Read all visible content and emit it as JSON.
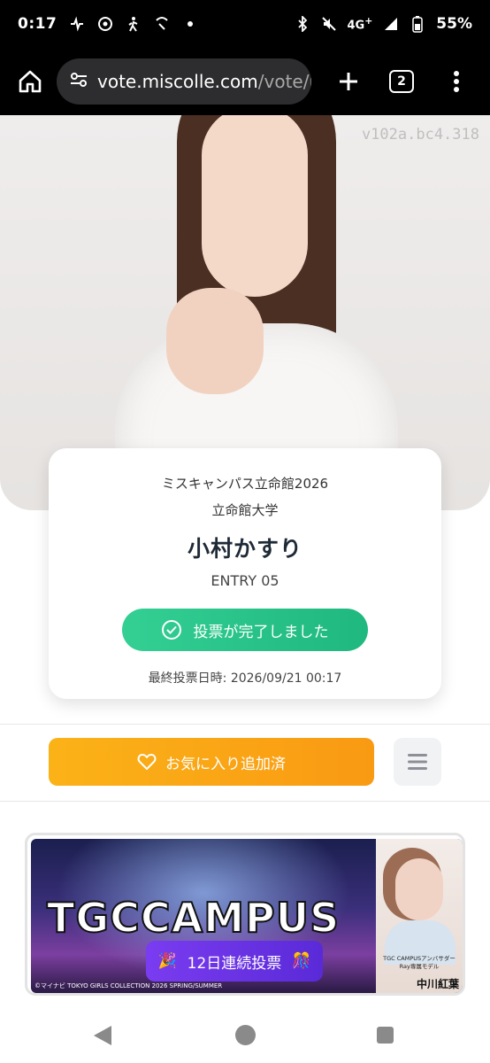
{
  "status_bar": {
    "time": "0:17",
    "network": "4G",
    "network_sup": "+",
    "battery": "55%"
  },
  "browser": {
    "url_main": "vote.miscolle.com",
    "url_dim": "/vote/r",
    "tab_count": "2"
  },
  "hero": {
    "watermark": "v102a.bc4.318"
  },
  "entry": {
    "contest": "ミスキャンパス立命館2026",
    "university": "立命館大学",
    "name": "小村かすり",
    "entry_number": "ENTRY 05",
    "vote_status": "投票が完了しました",
    "last_vote": "最終投票日時: 2026/09/21 00:17",
    "status_color": "#2cc58b"
  },
  "actions": {
    "favorite_label": "お気に入り追加済",
    "favorite_color": "#f9a815"
  },
  "banner": {
    "title": "TGCCAMPUS",
    "vote_label": "12日連続投票",
    "credit": "©マイナビ TOKYO GIRLS COLLECTION 2026 SPRING/SUMMER",
    "model_role": "TGC CAMPUSアンバサダー",
    "model_sub": "Ray専属モデル",
    "model_name": "中川紅葉"
  }
}
